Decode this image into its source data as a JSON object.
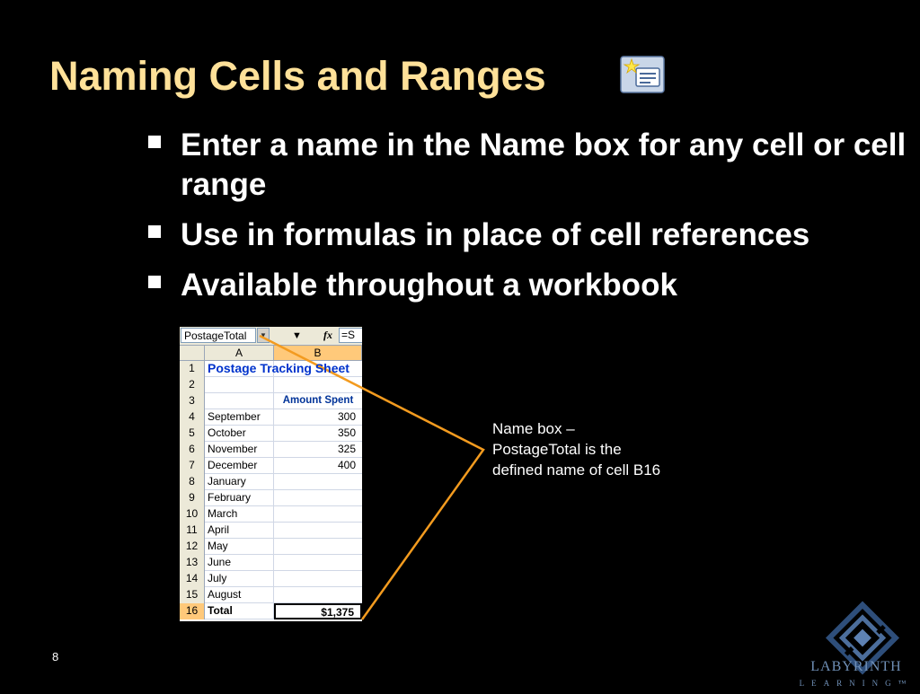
{
  "slide": {
    "title": "Naming Cells and Ranges",
    "bullets": [
      "Enter a name in the Name box for any cell or cell range",
      "Use in formulas in place of cell references",
      "Available throughout a workbook"
    ],
    "page_number": "8",
    "title_color": "#FFE199",
    "title_icon": "name-define-icon"
  },
  "sheet": {
    "name_box": "PostageTotal",
    "fx_label": "fx",
    "formula_value": "=S",
    "columns": [
      "A",
      "B"
    ],
    "rows": [
      {
        "num": "1",
        "a": "Postage Tracking Sheet",
        "b": ""
      },
      {
        "num": "2",
        "a": "",
        "b": ""
      },
      {
        "num": "3",
        "a": "",
        "b": "Amount Spent"
      },
      {
        "num": "4",
        "a": "September",
        "b": "300"
      },
      {
        "num": "5",
        "a": "October",
        "b": "350"
      },
      {
        "num": "6",
        "a": "November",
        "b": "325"
      },
      {
        "num": "7",
        "a": "December",
        "b": "400"
      },
      {
        "num": "8",
        "a": "January",
        "b": ""
      },
      {
        "num": "9",
        "a": "February",
        "b": ""
      },
      {
        "num": "10",
        "a": "March",
        "b": ""
      },
      {
        "num": "11",
        "a": "April",
        "b": ""
      },
      {
        "num": "12",
        "a": "May",
        "b": ""
      },
      {
        "num": "13",
        "a": "June",
        "b": ""
      },
      {
        "num": "14",
        "a": "July",
        "b": ""
      },
      {
        "num": "15",
        "a": "August",
        "b": ""
      },
      {
        "num": "16",
        "a": "Total",
        "b": "$1,375"
      }
    ]
  },
  "callout": {
    "line1": "Name box –",
    "line2": "PostageTotal is the",
    "line3": "defined name of cell B16",
    "line_color": "#F39B1F"
  },
  "logo": {
    "name": "LABYRINTH",
    "sub": "LEARNING™"
  }
}
